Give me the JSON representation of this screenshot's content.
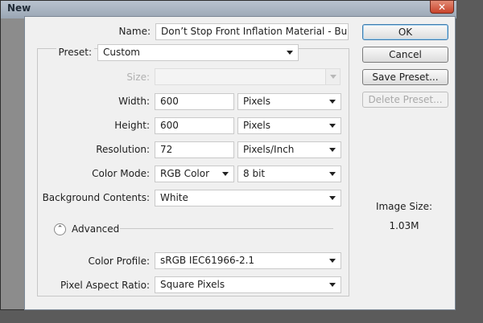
{
  "window": {
    "title": "New",
    "close_glyph": "✕"
  },
  "form": {
    "name": {
      "label": "Name:",
      "value": "Don’t Stop Front Inflation Material - Bump"
    },
    "preset": {
      "label": "Preset:",
      "value": "Custom"
    },
    "size": {
      "label": "Size:",
      "value": ""
    },
    "width": {
      "label": "Width:",
      "value": "600",
      "unit": "Pixels"
    },
    "height": {
      "label": "Height:",
      "value": "600",
      "unit": "Pixels"
    },
    "resolution": {
      "label": "Resolution:",
      "value": "72",
      "unit": "Pixels/Inch"
    },
    "color_mode": {
      "label": "Color Mode:",
      "value": "RGB Color",
      "depth": "8 bit"
    },
    "background": {
      "label": "Background Contents:",
      "value": "White"
    },
    "advanced": {
      "label": "Advanced",
      "toggle_glyph": "⌃"
    },
    "color_profile": {
      "label": "Color Profile:",
      "value": "sRGB IEC61966-2.1"
    },
    "pixel_aspect": {
      "label": "Pixel Aspect Ratio:",
      "value": "Square Pixels"
    }
  },
  "buttons": {
    "ok": "OK",
    "cancel": "Cancel",
    "save_preset": "Save Preset...",
    "delete_preset": "Delete Preset..."
  },
  "info": {
    "image_size_label": "Image Size:",
    "image_size_value": "1.03M"
  }
}
